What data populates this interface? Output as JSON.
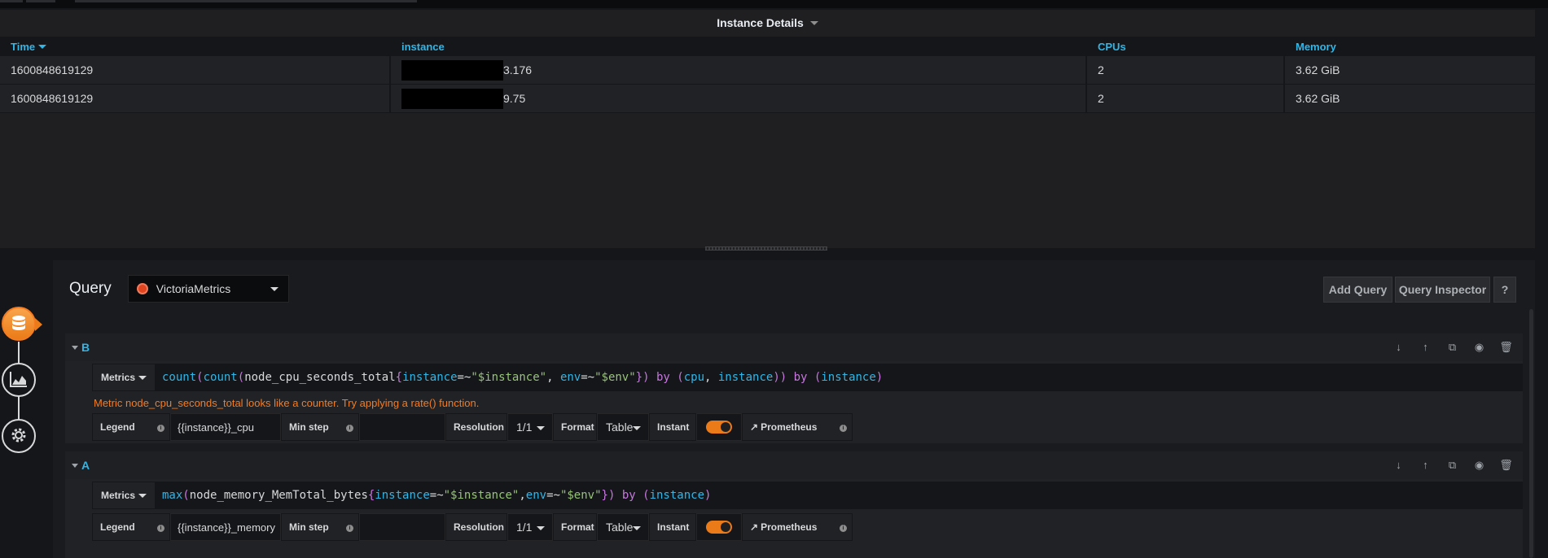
{
  "panel": {
    "title": "Instance Details",
    "columns": [
      "Time",
      "instance",
      "CPUs",
      "Memory"
    ],
    "rows": [
      {
        "time": "1600848619129",
        "instance": "3.176",
        "cpus": "2",
        "memory": "3.62 GiB"
      },
      {
        "time": "1600848619129",
        "instance": "9.75",
        "cpus": "2",
        "memory": "3.62 GiB"
      }
    ]
  },
  "rail": {
    "items": [
      {
        "icon": "database-icon",
        "active": true
      },
      {
        "icon": "chart-area-icon",
        "active": false
      },
      {
        "icon": "gear-icon",
        "active": false
      }
    ]
  },
  "editor": {
    "title": "Query",
    "datasource": "VictoriaMetrics",
    "add_query": "Add Query",
    "query_inspector": "Query Inspector",
    "help": "?"
  },
  "queries": [
    {
      "ref": "B",
      "metrics_label": "Metrics",
      "warning": "Metric node_cpu_seconds_total looks like a counter. Try applying a rate() function.",
      "expr_parts": [
        {
          "t": "count",
          "c": "kw"
        },
        {
          "t": "(",
          "c": "br"
        },
        {
          "t": "count",
          "c": "kw"
        },
        {
          "t": "(",
          "c": "br"
        },
        {
          "t": "node_cpu_seconds_total",
          "c": ""
        },
        {
          "t": "{",
          "c": "br"
        },
        {
          "t": "instance",
          "c": "lbl"
        },
        {
          "t": "=~",
          "c": ""
        },
        {
          "t": "\"$instance\"",
          "c": "str"
        },
        {
          "t": ", ",
          "c": ""
        },
        {
          "t": "env",
          "c": "lbl"
        },
        {
          "t": "=~",
          "c": ""
        },
        {
          "t": "\"$env\"",
          "c": "str"
        },
        {
          "t": "}",
          "c": "br"
        },
        {
          "t": ")",
          "c": "br"
        },
        {
          "t": " ",
          "c": ""
        },
        {
          "t": "by",
          "c": "br"
        },
        {
          "t": " ",
          "c": ""
        },
        {
          "t": "(",
          "c": "br"
        },
        {
          "t": "cpu",
          "c": "lbl"
        },
        {
          "t": ", ",
          "c": ""
        },
        {
          "t": "instance",
          "c": "lbl"
        },
        {
          "t": ")",
          "c": "br"
        },
        {
          "t": ")",
          "c": "br"
        },
        {
          "t": " ",
          "c": ""
        },
        {
          "t": "by",
          "c": "br"
        },
        {
          "t": " ",
          "c": ""
        },
        {
          "t": "(",
          "c": "br"
        },
        {
          "t": "instance",
          "c": "lbl"
        },
        {
          "t": ")",
          "c": "br"
        }
      ],
      "legend_label": "Legend",
      "legend_value": "{{instance}}_cpu",
      "min_step_label": "Min step",
      "min_step_value": "",
      "resolution_label": "Resolution",
      "resolution_value": "1/1",
      "format_label": "Format",
      "format_value": "Table",
      "instant_label": "Instant",
      "instant_on": true,
      "prometheus_label": "Prometheus"
    },
    {
      "ref": "A",
      "metrics_label": "Metrics",
      "warning": "",
      "expr_parts": [
        {
          "t": "max",
          "c": "kw"
        },
        {
          "t": "(",
          "c": "br"
        },
        {
          "t": "node_memory_MemTotal_bytes",
          "c": ""
        },
        {
          "t": "{",
          "c": "br"
        },
        {
          "t": "instance",
          "c": "lbl"
        },
        {
          "t": "=~",
          "c": ""
        },
        {
          "t": "\"$instance\"",
          "c": "str"
        },
        {
          "t": ",",
          "c": ""
        },
        {
          "t": "env",
          "c": "lbl"
        },
        {
          "t": "=~",
          "c": ""
        },
        {
          "t": "\"$env\"",
          "c": "str"
        },
        {
          "t": "}",
          "c": "br"
        },
        {
          "t": ")",
          "c": "br"
        },
        {
          "t": " ",
          "c": ""
        },
        {
          "t": "by",
          "c": "br"
        },
        {
          "t": " ",
          "c": ""
        },
        {
          "t": "(",
          "c": "br"
        },
        {
          "t": "instance",
          "c": "lbl"
        },
        {
          "t": ")",
          "c": "br"
        }
      ],
      "legend_label": "Legend",
      "legend_value": "{{instance}}_memory",
      "min_step_label": "Min step",
      "min_step_value": "",
      "resolution_label": "Resolution",
      "resolution_value": "1/1",
      "format_label": "Format",
      "format_value": "Table",
      "instant_label": "Instant",
      "instant_on": true,
      "prometheus_label": "Prometheus"
    }
  ],
  "colors": {
    "accent_blue": "#33b5e5",
    "accent_orange": "#eb7b18",
    "warning": "#f47b20",
    "background": "#141619"
  }
}
